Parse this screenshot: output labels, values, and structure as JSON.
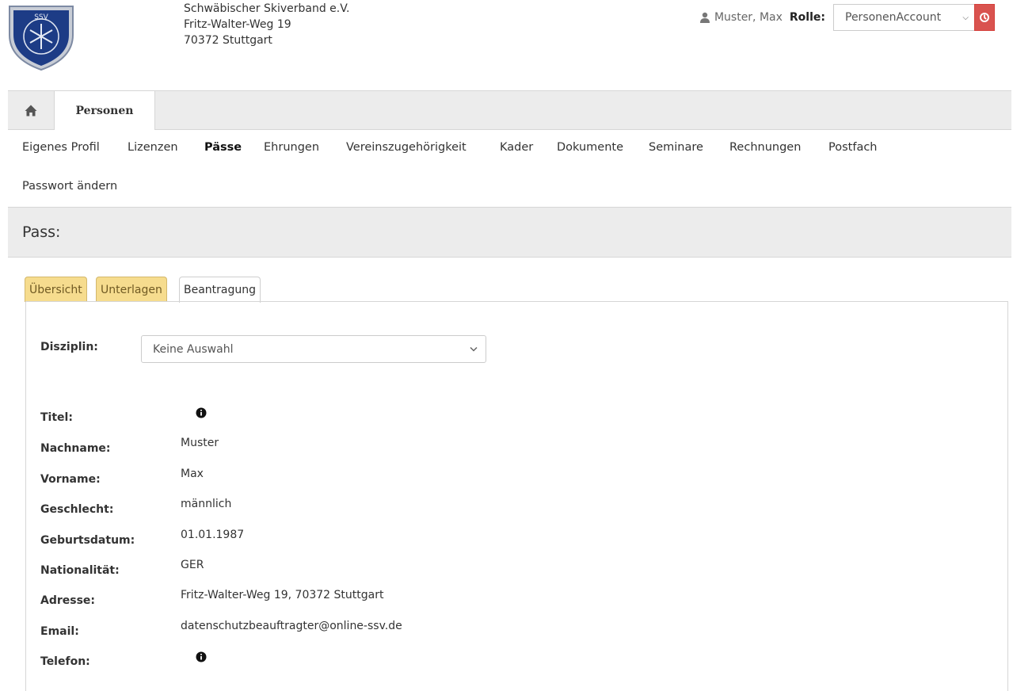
{
  "org": {
    "name": "Schwäbischer Skiverband e.V.",
    "street": "Fritz-Walter-Weg 19",
    "city": "70372 Stuttgart",
    "logo_text": "SSV"
  },
  "user": {
    "name": "Muster, Max",
    "role_label": "Rolle:",
    "role_value": "PersonenAccount"
  },
  "tabs": {
    "home_icon": "home-icon",
    "active": "Personen"
  },
  "subnav": [
    "Eigenes Profil",
    "Lizenzen",
    "Pässe",
    "Ehrungen",
    "Vereinszugehörigkeit",
    "Kader",
    "Dokumente",
    "Seminare",
    "Rechnungen",
    "Postfach",
    "Passwort ändern"
  ],
  "page": {
    "title": "Pass:"
  },
  "form_tabs": [
    "Übersicht",
    "Unterlagen",
    "Beantragung"
  ],
  "form": {
    "disziplin_label": "Disziplin:",
    "disziplin_value": "Keine Auswahl",
    "fields": [
      {
        "label": "Titel:",
        "value": ""
      },
      {
        "label": "Nachname:",
        "value": "Muster"
      },
      {
        "label": "Vorname:",
        "value": "Max"
      },
      {
        "label": "Geschlecht:",
        "value": "männlich"
      },
      {
        "label": "Geburtsdatum:",
        "value": "01.01.1987"
      },
      {
        "label": "Nationalität:",
        "value": "GER"
      },
      {
        "label": "Adresse:",
        "value": "Fritz-Walter-Weg 19, 70372 Stuttgart"
      },
      {
        "label": "Email:",
        "value": "datenschutzbeauftragter@online-ssv.de"
      },
      {
        "label": "Telefon:",
        "value": ""
      }
    ]
  },
  "colors": {
    "logout": "#d9534f",
    "tab_yellow": "#f6dc8e",
    "bar_gray": "#ececec"
  }
}
